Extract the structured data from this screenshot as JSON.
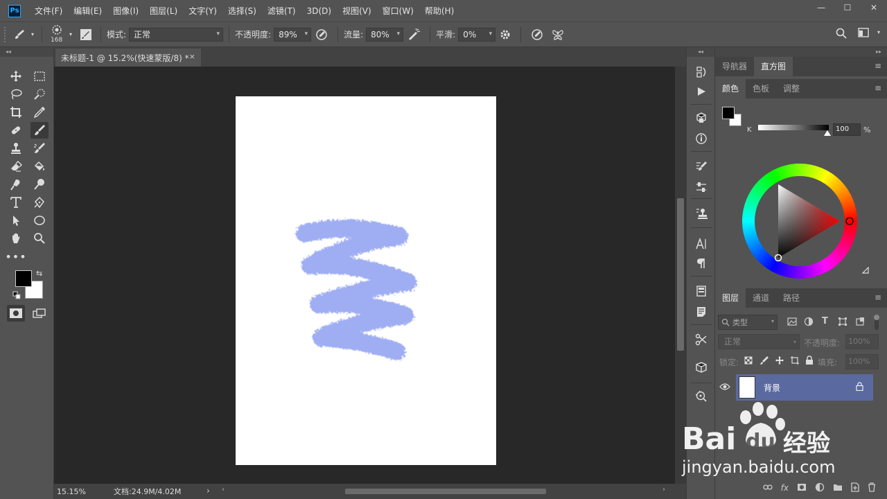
{
  "app": {
    "logo": "Ps"
  },
  "menu": [
    "文件(F)",
    "编辑(E)",
    "图像(I)",
    "图层(L)",
    "文字(Y)",
    "选择(S)",
    "滤镜(T)",
    "3D(D)",
    "视图(V)",
    "窗口(W)",
    "帮助(H)"
  ],
  "window_controls": {
    "minimize": "—",
    "maximize": "☐",
    "close": "✕"
  },
  "options": {
    "brush_size": "168",
    "mode_label": "模式:",
    "mode_value": "正常",
    "opacity_label": "不透明度:",
    "opacity_value": "89%",
    "flow_label": "流量:",
    "flow_value": "80%",
    "smooth_label": "平滑:",
    "smooth_value": "0%"
  },
  "document": {
    "tab_title": "未标题-1 @ 15.2%(快速蒙版/8) *",
    "tab_close": "×"
  },
  "status": {
    "zoom": "15.15%",
    "doc_info": "文档:24.9M/4.02M",
    "arrow": "›"
  },
  "panels": {
    "top_tabs": [
      "导航器",
      "直方图"
    ],
    "color_tabs": [
      "颜色",
      "色板",
      "调整"
    ],
    "k_label": "K",
    "k_value": "100",
    "k_unit": "%",
    "layer_tabs": [
      "图层",
      "通道",
      "路径"
    ],
    "layer_filter": "类型",
    "blend_mode": "正常",
    "opacity_label": "不透明度:",
    "opacity_value": "100%",
    "lock_label": "锁定:",
    "fill_label": "填充:",
    "fill_value": "100%",
    "layer_name": "背景"
  },
  "watermark": {
    "brand": "Bai",
    "brand_du": "du",
    "brand_cn": "经验",
    "url": "jingyan.baidu.com"
  },
  "colors": {
    "stroke": "#8f9ff0",
    "layer_selected": "#5a6aa0"
  }
}
